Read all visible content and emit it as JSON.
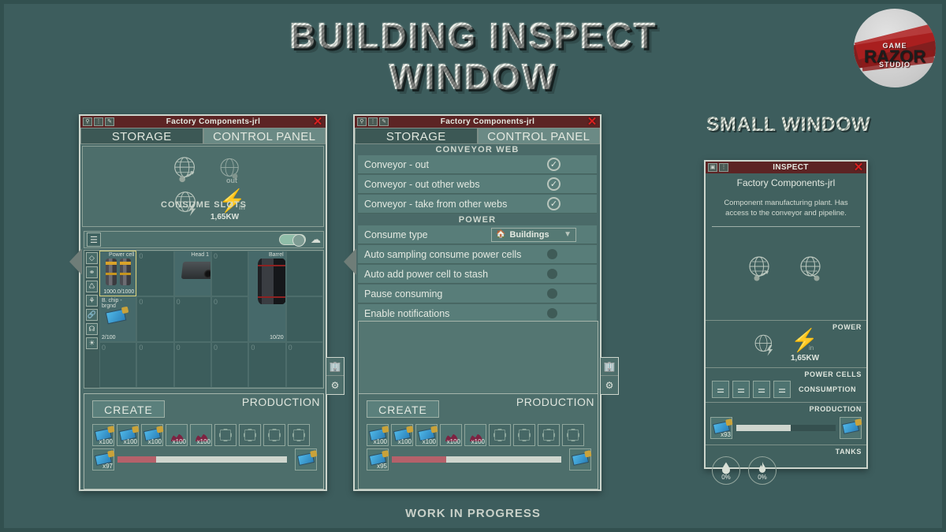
{
  "slide": {
    "title_line1": "BUILDING INSPECT",
    "title_line2": "WINDOW",
    "small_window_label": "SMALL WINDOW",
    "footer": "WORK IN PROGRESS"
  },
  "logo": {
    "top": "GAME",
    "mid": "RAZOR",
    "bottom": "STUDIO"
  },
  "colors": {
    "background": "#3d5d5d",
    "window_body": "#4a6a68",
    "titlebar": "#5c2424",
    "tab_active": "#6b8a85",
    "close_red": "#d92020",
    "progress_fill": "#b5616a",
    "toggle_on": "#8fbda8"
  },
  "window1": {
    "titlebar": {
      "title": "Factory Components-jrl",
      "close": "✕",
      "icons": [
        "inspect-icon",
        "info-icon",
        "edit-icon"
      ]
    },
    "tabs": [
      {
        "label": "STORAGE",
        "active": false
      },
      {
        "label": "CONTROL PANEL",
        "active": true
      }
    ],
    "power_summary": {
      "kw": "1,65KW",
      "in_label": "in",
      "out_label": "out"
    },
    "consume_slots_header": "CONSUME SLOTS",
    "rail_icons": [
      "layers-icon",
      "diamond-icon",
      "molecule-icon",
      "recycle-icon",
      "wrench-icon",
      "link-icon",
      "pipette-icon",
      "globe-icon"
    ],
    "grid_items": [
      {
        "name": "Power cell",
        "count": "1000.0/1000",
        "art": "powercell",
        "selected": true
      },
      {
        "name": "Head 1",
        "count": "",
        "art": "head",
        "selected": false
      },
      {
        "name": "Barrel",
        "count": "10/20",
        "art": "barrel",
        "selected": false
      },
      {
        "name": "B. chip - brgnd",
        "count": "2/100",
        "art": "chip",
        "selected": false
      }
    ],
    "empty_cell_value": "0",
    "production": {
      "label": "PRODUCTION",
      "create_button": "CREATE",
      "slots": [
        {
          "art": "chip",
          "qty": "x100"
        },
        {
          "art": "chip",
          "qty": "x100"
        },
        {
          "art": "chip",
          "qty": "x100"
        },
        {
          "art": "ore",
          "qty": "x100"
        },
        {
          "art": "ore",
          "qty": "x100"
        },
        {
          "art": "empty",
          "qty": ""
        },
        {
          "art": "empty",
          "qty": ""
        },
        {
          "art": "empty",
          "qty": ""
        },
        {
          "art": "empty",
          "qty": ""
        }
      ],
      "input_qty": "x97",
      "progress_percent": 23
    },
    "side_buttons": [
      "building-icon",
      "gears-icon"
    ]
  },
  "window2": {
    "titlebar": {
      "title": "Factory Components-jrl",
      "close": "✕",
      "icons": [
        "inspect-icon",
        "info-icon",
        "edit-icon"
      ]
    },
    "tabs": [
      {
        "label": "STORAGE",
        "active": false
      },
      {
        "label": "CONTROL PANEL",
        "active": true
      }
    ],
    "sections": [
      {
        "header": "CONVEYOR WEB",
        "rows": [
          {
            "label": "Conveyor - out",
            "control": "check",
            "value": true
          },
          {
            "label": "Conveyor - out other webs",
            "control": "check",
            "value": true
          },
          {
            "label": "Conveyor - take from other webs",
            "control": "check",
            "value": true
          }
        ]
      },
      {
        "header": "POWER",
        "rows": [
          {
            "label": "Consume type",
            "control": "dropdown",
            "value": "Buildings"
          },
          {
            "label": "Auto sampling consume power cells",
            "control": "dot",
            "value": false
          },
          {
            "label": "Auto add power cell to stash",
            "control": "dot",
            "value": false
          },
          {
            "label": "Pause consuming",
            "control": "dot",
            "value": false
          },
          {
            "label": "Enable notifications",
            "control": "dot",
            "value": false
          }
        ]
      }
    ],
    "production": {
      "label": "PRODUCTION",
      "create_button": "CREATE",
      "slots": [
        {
          "art": "chip",
          "qty": "x100"
        },
        {
          "art": "chip",
          "qty": "x100"
        },
        {
          "art": "chip",
          "qty": "x100"
        },
        {
          "art": "ore",
          "qty": "x100"
        },
        {
          "art": "ore",
          "qty": "x100"
        },
        {
          "art": "empty",
          "qty": ""
        },
        {
          "art": "empty",
          "qty": ""
        },
        {
          "art": "empty",
          "qty": ""
        },
        {
          "art": "empty",
          "qty": ""
        }
      ],
      "input_qty": "x95",
      "progress_percent": 32
    },
    "side_buttons": [
      "building-icon",
      "gears-icon"
    ]
  },
  "window3": {
    "titlebar": {
      "title": "INSPECT",
      "close": "✕",
      "icons": [
        "camera-icon",
        "info-icon"
      ]
    },
    "subtitle": "Factory Components-jrl",
    "description": "Component manufacturing plant. Has access to the conveyor and pipeline.",
    "power": {
      "label": "POWER",
      "kw": "1,65KW",
      "in_label": "in"
    },
    "power_cells": {
      "label": "POWER CELLS",
      "consumption_label": "CONSUMPTION",
      "cells": [
        "cells-icon",
        "cells-icon",
        "cells-icon",
        "cells-icon"
      ]
    },
    "production": {
      "label": "PRODUCTION",
      "input_qty": "x93",
      "progress_percent": 55
    },
    "tanks": {
      "label": "TANKS",
      "items": [
        {
          "icon": "water-drop-icon",
          "value": "0%"
        },
        {
          "icon": "flame-icon",
          "value": "0%"
        }
      ]
    }
  }
}
